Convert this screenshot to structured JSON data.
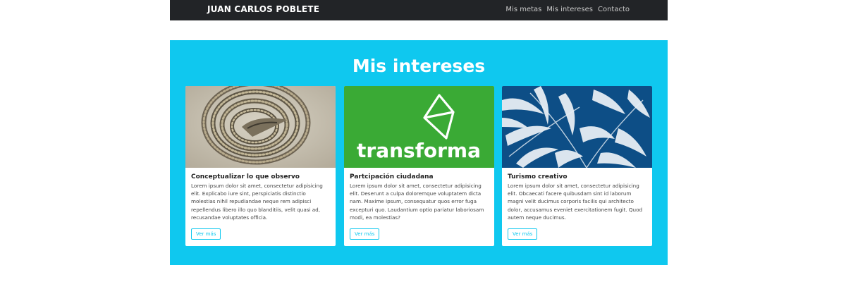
{
  "navbar": {
    "brand": "JUAN CARLOS POBLETE",
    "links": [
      "Mis metas",
      "Mis intereses",
      "Contacto"
    ],
    "background": "#222427"
  },
  "section": {
    "title": "Mis intereses",
    "background": "#0fc8ef"
  },
  "cards": [
    {
      "title": "Conceptualizar lo que observo",
      "text": "Lorem ipsum dolor sit amet, consectetur adipisicing elit. Explicabo iure sint, perspiciatis distinctio molestias nihil repudiandae neque rem adipisci repellendus libero illo quo blanditiis, velit quasi ad, recusandae voluptates officia.",
      "button": "Ver más",
      "image": "coiled-rope-photo"
    },
    {
      "title": "Partcipación ciudadana",
      "text": "Lorem ipsum dolor sit amet, consectetur adipisicing elit. Deserunt a culpa doloremque voluptatem dicta nam. Maxime ipsum, consequatur quos error fuga excepturi quo. Laudantium optio pariatur laboriosam modi, ea molestias?",
      "button": "Ver más",
      "image": "transforma-logo",
      "logo_text": "transforma",
      "logo_background": "#3aaa35"
    },
    {
      "title": "Turismo creativo",
      "text": "Lorem ipsum dolor sit amet, consectetur adipisicing elit. Obcaecati facere quibusdam sint id laborum magni velit ducimus corporis facilis qui architecto dolor, accusamus eveniet exercitationem fugit. Quod autem neque ducimus.",
      "button": "Ver más",
      "image": "cyanotype-leaves"
    }
  ]
}
